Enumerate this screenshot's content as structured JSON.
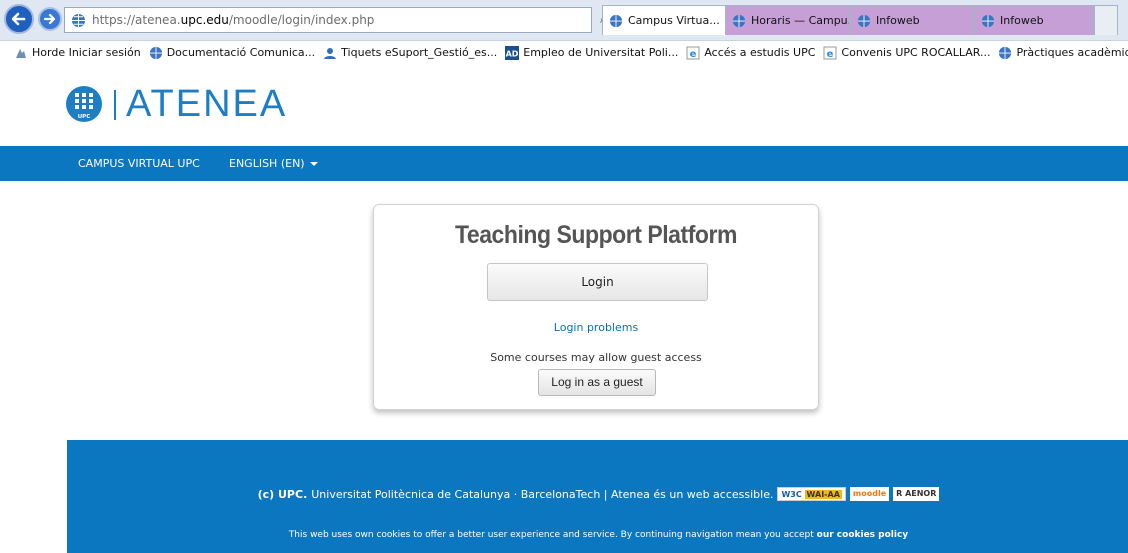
{
  "browser": {
    "url_prefix": "https://atenea.",
    "url_domain": "upc.edu",
    "url_path": "/moodle/login/index.php",
    "tools": "⌕ ▾ 🔒 ↻",
    "tabs": [
      {
        "label": "Campus Virtua...",
        "close": "×",
        "active": true
      },
      {
        "label": "Horaris — Campu...",
        "active": false
      },
      {
        "label": "Infoweb",
        "active": false
      },
      {
        "label": "Infoweb",
        "active": false
      }
    ],
    "favorites": [
      {
        "label": "Horde Iniciar sesión",
        "icon": "horde-icon"
      },
      {
        "label": "Documentació Comunica...",
        "icon": "globe-icon"
      },
      {
        "label": "Tiquets eSuport_Gestió_es...",
        "icon": "user-icon"
      },
      {
        "label": "Empleo de Universitat Poli...",
        "icon": "ad-icon"
      },
      {
        "label": "Accés a estudis UPC",
        "icon": "ie-icon"
      },
      {
        "label": "Convenis UPC ROCALLAR...",
        "icon": "ie-icon"
      },
      {
        "label": "Pràctiques acadèmiques e...",
        "icon": "globe-icon"
      }
    ]
  },
  "site": {
    "logo_text": "ATENEA",
    "nav": {
      "campus": "CAMPUS VIRTUAL UPC",
      "language": "ENGLISH (EN)"
    }
  },
  "login": {
    "title": "Teaching Support Platform",
    "login_button": "Login",
    "problems_link": "Login problems",
    "guest_note": "Some courses may allow guest access",
    "guest_button": "Log in as a guest"
  },
  "footer": {
    "copyright_bold": "(c) UPC.",
    "copyright_text": "Universitat Politècnica de Catalunya · BarcelonaTech | Atenea és un web accessible.",
    "badge_w3c": "W3C",
    "badge_wai": "WAI-AA",
    "badge_moodle": "moodle",
    "badge_aenor": "R AENOR",
    "cookie_text": "This web uses own cookies to offer a better user experience and service. By continuing navigation mean you accept",
    "cookie_link": "our cookies policy"
  },
  "colors": {
    "brand_blue": "#0b77c1",
    "link_blue": "#0b6fb5",
    "tab_purple": "#c69fd6"
  }
}
